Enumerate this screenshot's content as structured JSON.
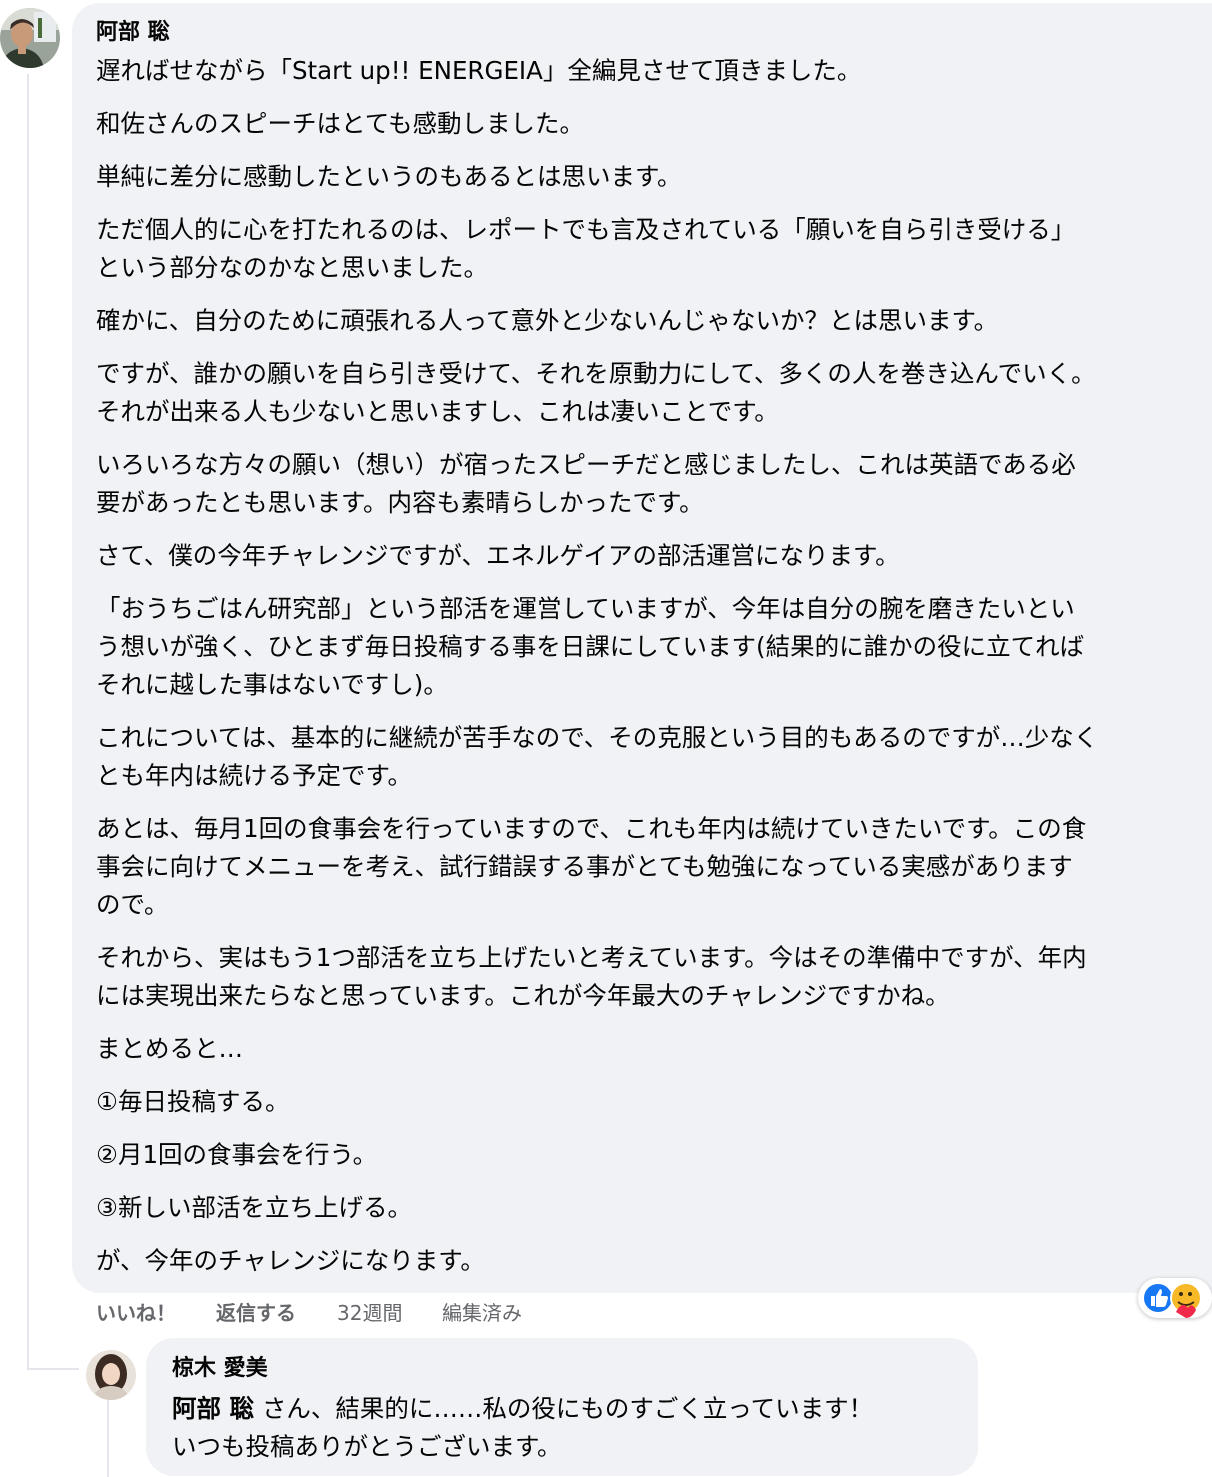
{
  "comment": {
    "author": "阿部 聡",
    "paragraphs": [
      "遅ればせながら「Start up!! ENERGEIA」全編見させて頂きました。",
      "和佐さんのスピーチはとても感動しました。",
      "単純に差分に感動したというのもあるとは思います。",
      "ただ個人的に心を打たれるのは、レポートでも言及されている「願いを自ら引き受ける」\nという部分なのかなと思いました。",
      "確かに、自分のために頑張れる人って意外と少ないんじゃないか？とは思います。",
      "ですが、誰かの願いを自ら引き受けて、それを原動力にして、多くの人を巻き込んでいく。\nそれが出来る人も少ないと思いますし、これは凄いことです。",
      "いろいろな方々の願い（想い）が宿ったスピーチだと感じましたし、これは英語である必\n要があったとも思います。内容も素晴らしかったです。",
      "さて、僕の今年チャレンジですが、エネルゲイアの部活運営になります。",
      "「おうちごはん研究部」という部活を運営していますが、今年は自分の腕を磨きたいとい\nう想いが強く、ひとまず毎日投稿する事を日課にしています(結果的に誰かの役に立てれば\nそれに越した事はないですし)。",
      "これについては、基本的に継続が苦手なので、その克服という目的もあるのですが…少なく\nとも年内は続ける予定です。",
      "あとは、毎月1回の食事会を行っていますので、これも年内は続けていきたいです。この食\n事会に向けてメニューを考え、試行錯誤する事がとても勉強になっている実感があります\nので。",
      "それから、実はもう1つ部活を立ち上げたいと考えています。今はその準備中ですが、年内\nには実現出来たらなと思っています。これが今年最大のチャレンジですかね。",
      "まとめると…",
      "①毎日投稿する。",
      "②月1回の食事会を行う。",
      "③新しい部活を立ち上げる。",
      "が、今年のチャレンジになります。"
    ],
    "actions": {
      "like": "いいね！",
      "reply": "返信する",
      "time": "32週間",
      "edited": "編集済み"
    },
    "reaction_icons": [
      "like-icon",
      "care-icon"
    ]
  },
  "reply": {
    "author": "椋木 愛美",
    "mention": "阿部 聡",
    "line1_rest": " さん、結果的に……私の役にものすごく立っています！",
    "line2": "いつも投稿ありがとうございます。"
  },
  "colors": {
    "bubble": "#f0f2f5",
    "meta_text": "#65676b",
    "like_blue": "#1877f2",
    "care_yellow": "#f7b928"
  }
}
